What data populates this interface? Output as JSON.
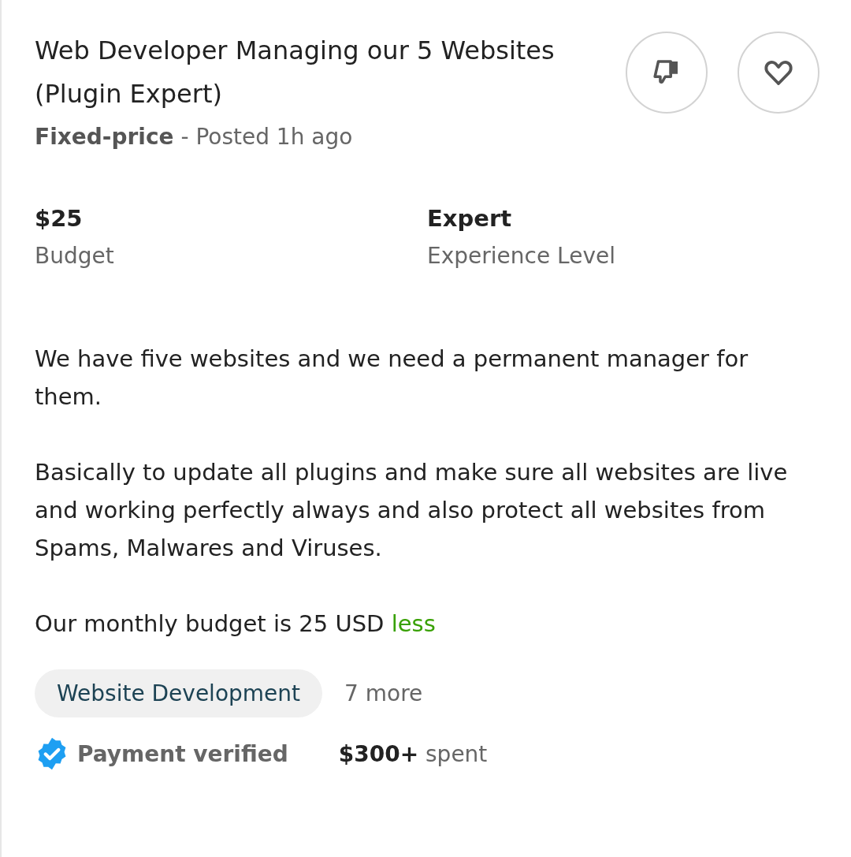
{
  "job": {
    "title": "Web Developer Managing our 5 Websites (Plugin Expert)",
    "meta": "**Fixed-price** - Posted 1h ago"
  },
  "actions": [
    {
      "kind": "dislike"
    },
    {
      "kind": "save"
    }
  ],
  "stats": [
    {
      "value": "$25",
      "label": "Budget"
    },
    {
      "value": "Expert",
      "label": "Experience Level"
    }
  ],
  "description": {
    "paragraphs": [
      "We have five websites and we need a permanent manager for them.",
      "Basically to update all plugins and make sure all websites are live and working perfectly always and also protect all websites from Spams, Malwares and Viruses.",
      "Our monthly budget is 25 USD"
    ],
    "toggle_link": "less"
  },
  "skills": {
    "tags": [
      "Website Development"
    ],
    "more": "7 more"
  },
  "client": {
    "payment": "Payment verified",
    "payment_verified": true,
    "spent": "**$300+** spent"
  }
}
